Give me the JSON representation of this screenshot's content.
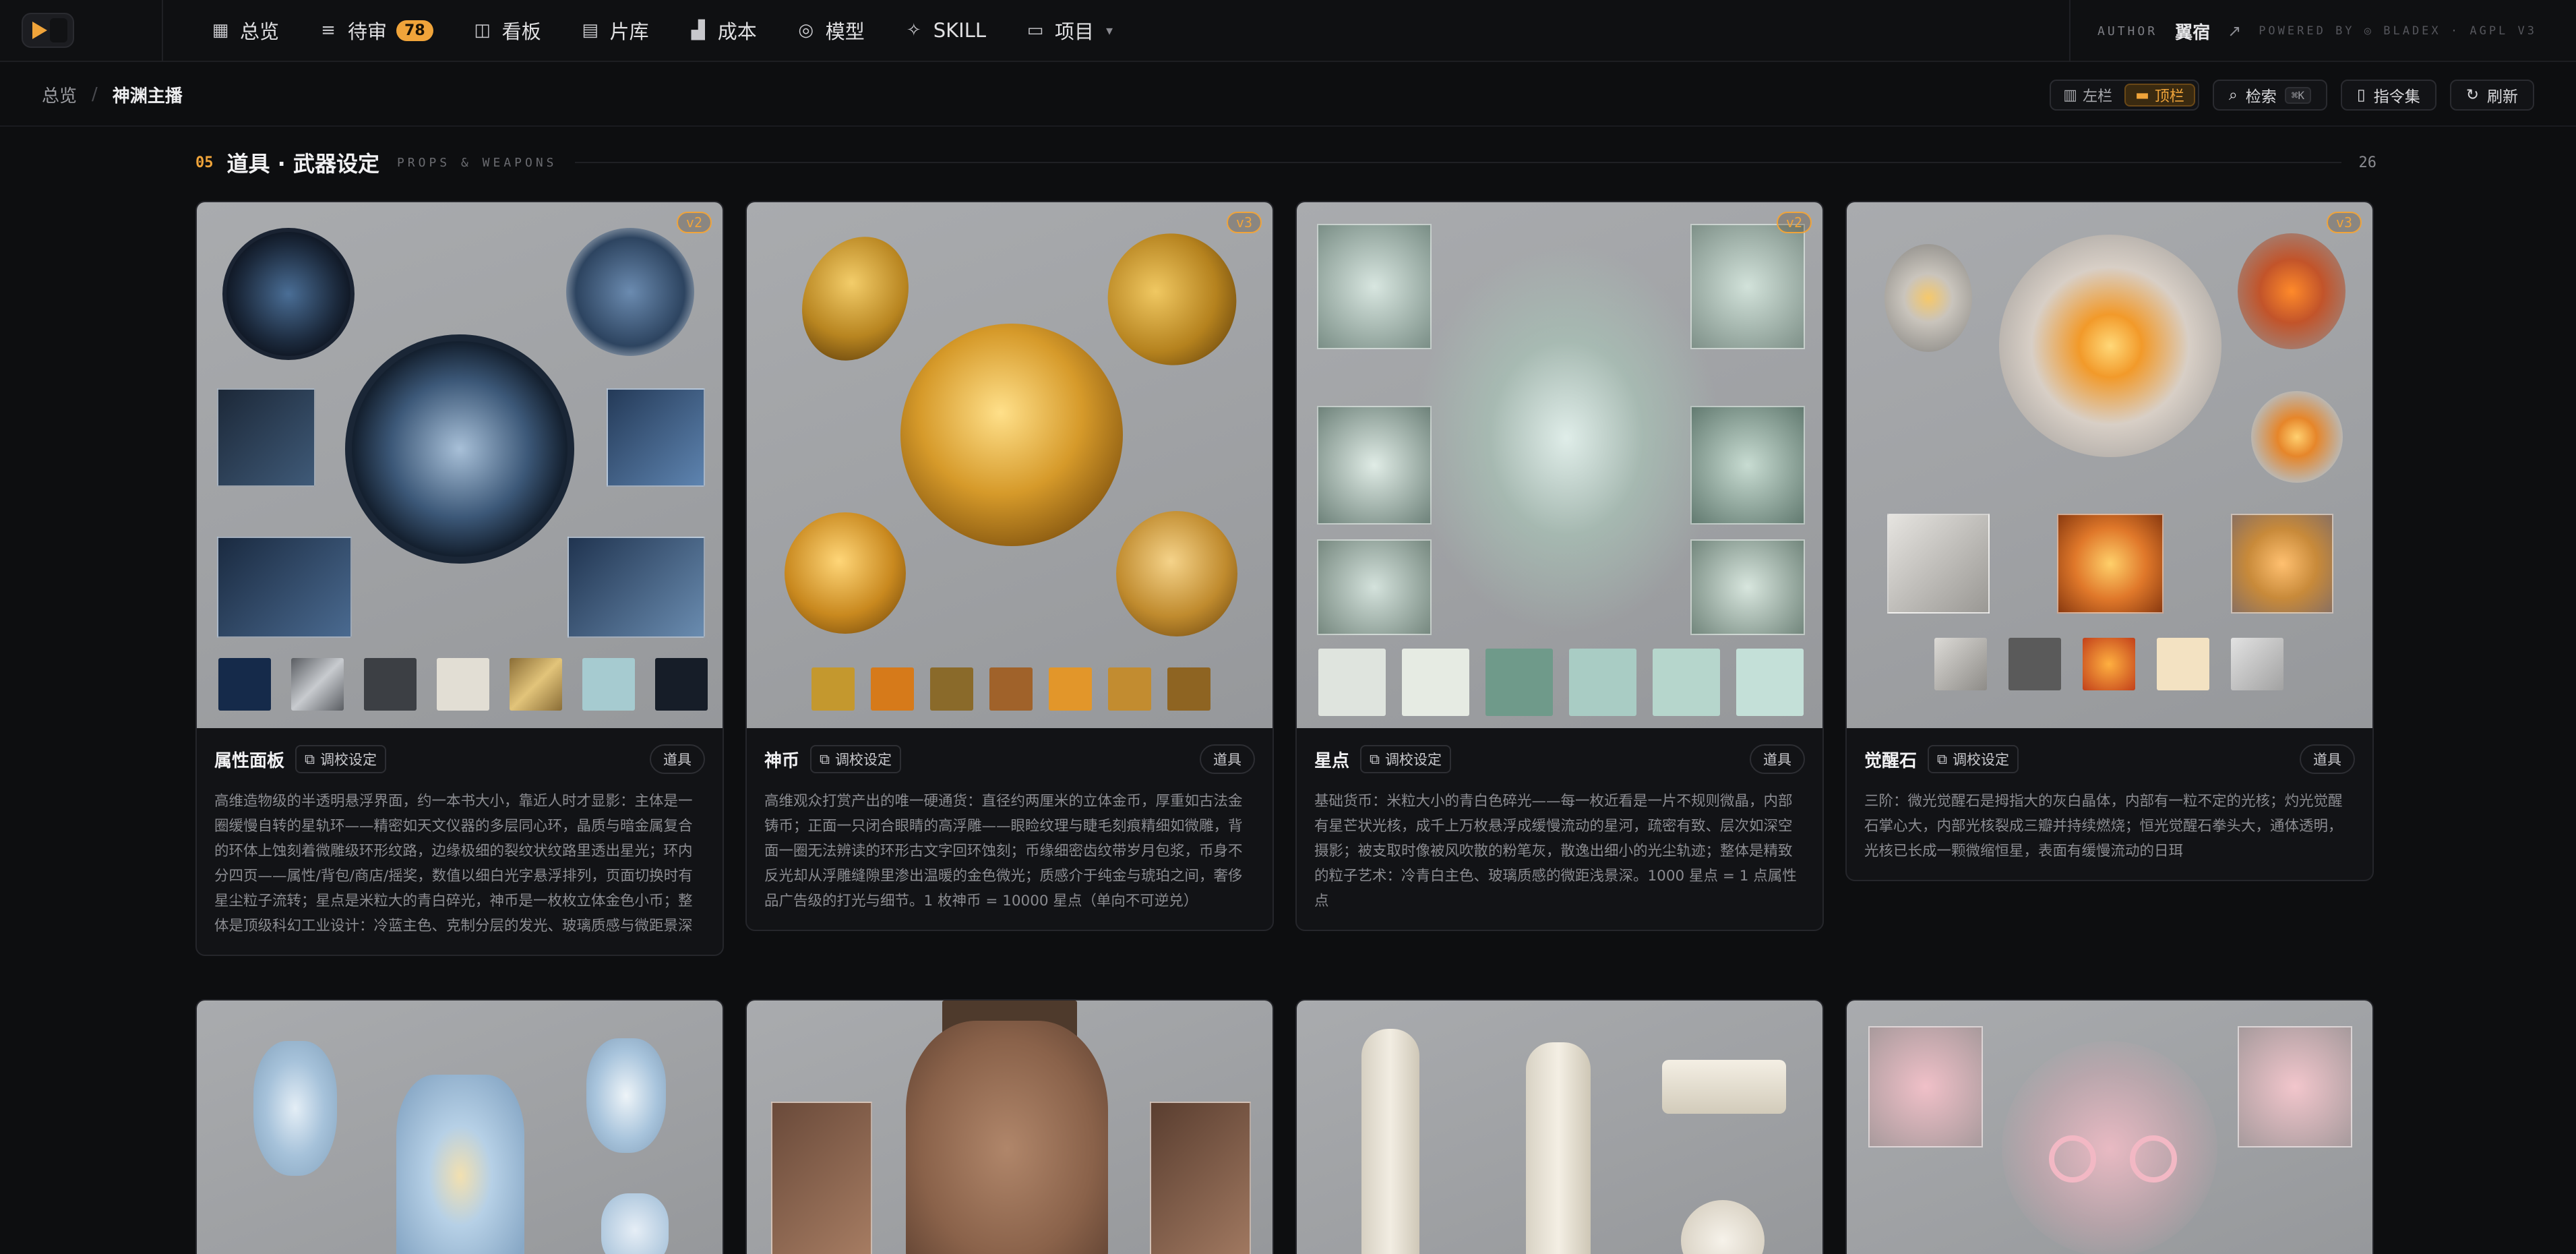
{
  "nav": {
    "items": [
      {
        "label": "总览",
        "icon": "grid-icon"
      },
      {
        "label": "待审",
        "icon": "review-icon",
        "badge": "78"
      },
      {
        "label": "看板",
        "icon": "board-icon"
      },
      {
        "label": "片库",
        "icon": "film-icon"
      },
      {
        "label": "成本",
        "icon": "chart-icon"
      },
      {
        "label": "模型",
        "icon": "model-icon"
      },
      {
        "label": "SKILL",
        "icon": "sparkle-icon"
      },
      {
        "label": "项目",
        "icon": "folder-icon"
      }
    ],
    "author_label": "AUTHOR",
    "author_name": "翼宿",
    "powered_by": "POWERED BY ◎ BLADEX · AGPL V3"
  },
  "breadcrumb": {
    "root": "总览",
    "separator": "/",
    "current": "神渊主播"
  },
  "toolbar": {
    "layout_left": "左栏",
    "layout_top": "顶栏",
    "search_label": "检索",
    "search_kbd": "⌘K",
    "commands_label": "指令集",
    "refresh_label": "刷新"
  },
  "section": {
    "number": "05",
    "title": "道具 · 武器设定",
    "subtitle": "PROPS & WEAPONS",
    "count": "26"
  },
  "cards": [
    {
      "title": "属性面板",
      "link": "调校设定",
      "tag": "道具",
      "version": "v2",
      "desc": "高维造物级的半透明悬浮界面，约一本书大小，靠近人时才显影：主体是一圈缓慢自转的星轨环——精密如天文仪器的多层同心环，晶质与暗金属复合的环体上蚀刻着微雕级环形纹路，边缘极细的裂纹状纹路里透出星光；环内分四页——属性/背包/商店/摇奖，数值以细白光字悬浮排列，页面切换时有星尘粒子流转；星点是米粒大的青白碎光，神币是一枚枚立体金色小币；整体是顶级科幻工业设计：冷蓝主色、克制分层的发光、玻璃质感与微距景深"
    },
    {
      "title": "神币",
      "link": "调校设定",
      "tag": "道具",
      "version": "v3",
      "desc": "高维观众打赏产出的唯一硬通货：直径约两厘米的立体金币，厚重如古法金铸币；正面一只闭合眼睛的高浮雕——眼睑纹理与睫毛刻痕精细如微雕，背面一圈无法辨读的环形古文字回环蚀刻；币缘细密齿纹带岁月包浆，币身不反光却从浮雕缝隙里渗出温暖的金色微光；质感介于纯金与琥珀之间，奢侈品广告级的打光与细节。1 枚神币 = 10000 星点（单向不可逆兑）"
    },
    {
      "title": "星点",
      "link": "调校设定",
      "tag": "道具",
      "version": "v2",
      "desc": "基础货币：米粒大小的青白色碎光——每一枚近看是一片不规则微晶，内部有星芒状光核，成千上万枚悬浮成缓慢流动的星河，疏密有致、层次如深空摄影；被支取时像被风吹散的粉笔灰，散逸出细小的光尘轨迹；整体是精致的粒子艺术：冷青白主色、玻璃质感的微距浅景深。1000 星点 = 1 点属性点"
    },
    {
      "title": "觉醒石",
      "link": "调校设定",
      "tag": "道具",
      "version": "v3",
      "desc": "三阶：微光觉醒石是拇指大的灰白晶体，内部有一粒不定的光核；灼光觉醒石掌心大，内部光核裂成三瓣并持续燃烧；恒光觉醒石拳头大，通体透明，光核已长成一颗微缩恒星，表面有缓慢流动的日珥"
    }
  ]
}
